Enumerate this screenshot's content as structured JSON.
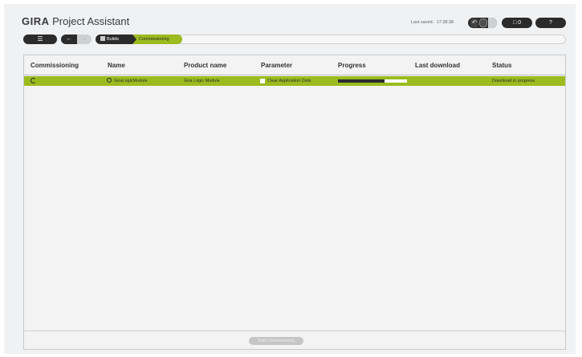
{
  "header": {
    "logo": "GIRA",
    "title": "Project Assistant",
    "last_saved_label": "Last saved:",
    "last_saved_time": "17:38:38",
    "undo_icon": "undo-icon",
    "messages_icon": "message-icon",
    "messages_count": "0",
    "help_label": "?"
  },
  "toolbar": {
    "menu_icon": "menu-icon",
    "back_icon": "back-arrow-icon",
    "forward_icon": "forward-arrow-icon",
    "breadcrumb": [
      {
        "label": "Builds",
        "icon": "building-icon"
      },
      {
        "label": "Commissioning"
      }
    ]
  },
  "table": {
    "columns": [
      "Commissioning",
      "Name",
      "Product name",
      "Parameter",
      "Progress",
      "Last download",
      "Status"
    ],
    "rows": [
      {
        "commissioning_icon": "spinner-icon",
        "name": "GiraLogicModule",
        "name_icon": "gear-icon",
        "product_name": "Gira Logic Module",
        "parameter": "Clear Application Data",
        "progress": 0.68,
        "last_download": "",
        "status": "Download in progress"
      }
    ]
  },
  "footer": {
    "start_button": "Start Commissioning"
  },
  "colors": {
    "accent": "#9cbb1f",
    "dark": "#2b2b2b",
    "background": "#f0f1f3"
  }
}
